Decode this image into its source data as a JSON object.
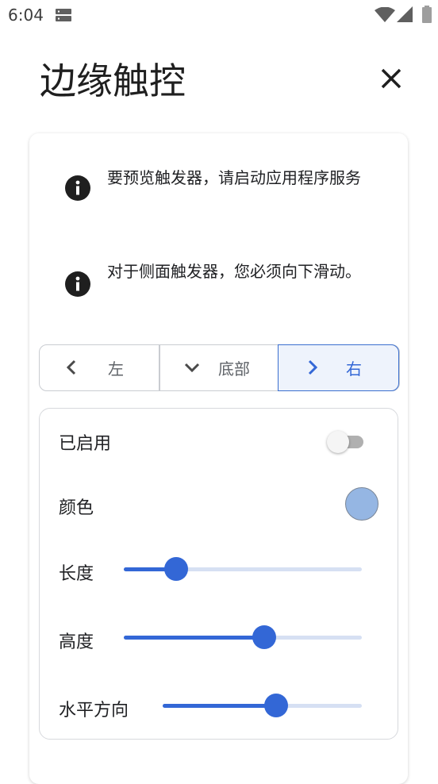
{
  "status": {
    "time": "6:04"
  },
  "header": {
    "title": "边缘触控"
  },
  "info": [
    {
      "text": "要预览触发器，请启动应用程序服务"
    },
    {
      "text": "对于侧面触发器，您必须向下滑动。"
    }
  ],
  "position_tabs": [
    {
      "label": "左",
      "selected": false
    },
    {
      "label": "底部",
      "selected": false
    },
    {
      "label": "右",
      "selected": true
    }
  ],
  "settings": {
    "enabled_label": "已启用",
    "enabled": false,
    "color_label": "颜色",
    "color": "#95b6e3",
    "length_label": "长度",
    "length_value": 0.22,
    "height_label": "高度",
    "height_value": 0.59,
    "horizontal_label": "水平方向",
    "horizontal_value": 0.57
  },
  "colors": {
    "accent": "#3367d6",
    "accent_light": "#d6e0f3"
  }
}
